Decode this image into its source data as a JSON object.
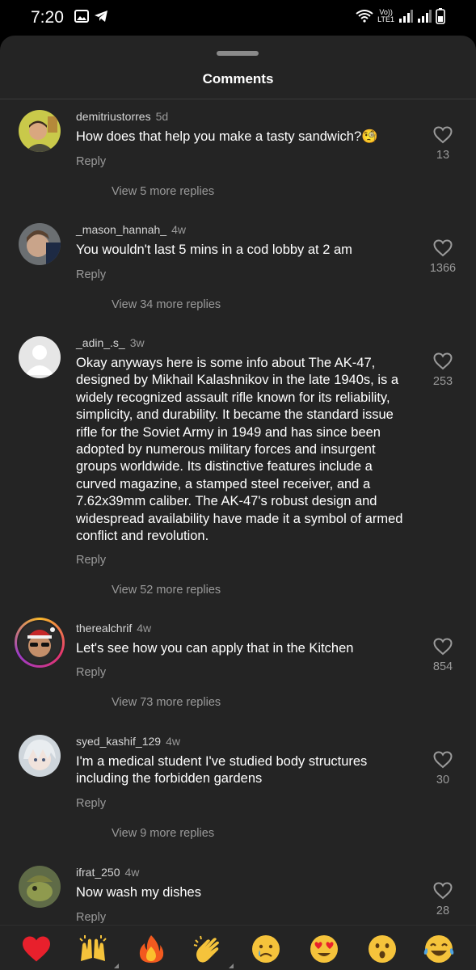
{
  "status_bar": {
    "time": "7:20",
    "network_top": "Vo))",
    "network_bottom": "LTE1"
  },
  "sheet": {
    "title": "Comments"
  },
  "comments": [
    {
      "username": "demitriustorres",
      "time": "5d",
      "text": "How does that help you make a tasty sandwich?🧐",
      "reply_label": "Reply",
      "likes": "13",
      "view_replies": "View 5 more replies"
    },
    {
      "username": "_mason_hannah_",
      "time": "4w",
      "text": "You wouldn't last 5 mins in a cod lobby at 2 am",
      "reply_label": "Reply",
      "likes": "1366",
      "view_replies": "View 34 more replies"
    },
    {
      "username": "_adin_.s_",
      "time": "3w",
      "text": "Okay anyways here is some info about The AK-47, designed by Mikhail Kalashnikov in the late 1940s, is a widely recognized assault rifle known for its reliability, simplicity, and durability. It became the standard issue rifle for the Soviet Army in 1949 and has since been adopted by numerous military forces and insurgent groups worldwide. Its distinctive features include a curved magazine, a stamped steel receiver, and a 7.62x39mm caliber. The AK-47's robust design and widespread availability have made it a symbol of armed conflict and revolution.",
      "reply_label": "Reply",
      "likes": "253",
      "view_replies": "View 52 more replies"
    },
    {
      "username": "therealchrif",
      "time": "4w",
      "text": "Let's see how you can apply that in the Kitchen",
      "reply_label": "Reply",
      "likes": "854",
      "view_replies": "View 73 more replies"
    },
    {
      "username": "syed_kashif_129",
      "time": "4w",
      "text": "I'm a medical student I've studied body structures including the forbidden gardens",
      "reply_label": "Reply",
      "likes": "30",
      "view_replies": "View 9 more replies"
    },
    {
      "username": "ifrat_250",
      "time": "4w",
      "text": "Now wash my dishes",
      "reply_label": "Reply",
      "likes": "28"
    }
  ],
  "quick_reactions": [
    "❤️",
    "🙌",
    "🔥",
    "👏",
    "😢",
    "😍",
    "😮",
    "😂"
  ],
  "colors": {
    "background": "#242424",
    "muted_text": "#9a9a9a",
    "heart_red": "#e8202c"
  }
}
